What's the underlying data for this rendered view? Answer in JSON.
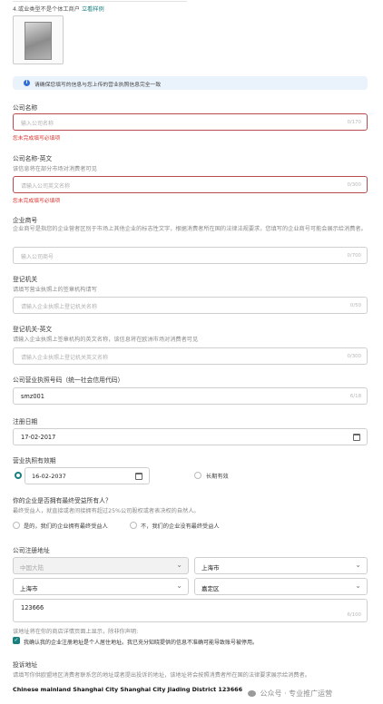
{
  "top": {
    "cut_text": "……………………………………………………………………………………",
    "note_prefix": "4.或业类型不是个体工商户",
    "note_link": "立看样例"
  },
  "info_banner": "请确保您填写的信息与您上传的营业执照信息完全一致",
  "company_name": {
    "label": "公司名称",
    "placeholder": "输入公司名称",
    "counter": "0/170",
    "error": "您未完成填写必填项"
  },
  "company_name_en": {
    "label": "公司名称-英文",
    "hint": "该信息将在部分市场对消费者可见",
    "placeholder": "请输入公司英文名称",
    "counter": "0/300",
    "error": "您未完成填写必填项"
  },
  "trade_name": {
    "label": "企业商号",
    "hint": "企业商号是指您的企业营者区别于市场上其他企业的标志性文字，根据消费者所在国的法律法规要求，您填写的企业商号可能会展示给消费者。",
    "placeholder": "输入公司商号",
    "counter": "0/700"
  },
  "registrar": {
    "label": "登记机关",
    "hint": "请填写营业执照上的签章机构请写",
    "placeholder": "请输入企业执照上登记机关名称",
    "counter": "0/50"
  },
  "registrar_en": {
    "label": "登记机关-英文",
    "hint": "请输入企业执照上签章机构的英文名称，该信息将在欧洲市场对消费者可见",
    "placeholder": "请输入企业执照上登记机关英文名称",
    "counter": "0/300"
  },
  "license_no": {
    "label": "公司营业执照号码（统一社会信用代码）",
    "value": "smz001",
    "counter": "6/18"
  },
  "reg_date": {
    "label": "注册日期",
    "value": "17-02-2017"
  },
  "validity": {
    "label": "营业执照有效期",
    "date": "16-02-2037",
    "long_term": "长期有效"
  },
  "beneficiary": {
    "question": "你的企业是否拥有最终受益所有人？",
    "hint": "最终受益人，就直接或者间接拥有超过25%公司股权或者表决权的自然人。",
    "option_yes": "是的，我们的企业拥有最终受益人",
    "option_no": "不，我们的企业没有最终受益人"
  },
  "address": {
    "label": "公司注册地址",
    "country": "中国大陆",
    "province": "上海市",
    "city": "上海市",
    "district": "嘉定区",
    "detail": "123666",
    "counter": "6/100",
    "note": "该地址将在你的商店详情页面上显示，除非你声明:",
    "declare": "我确认我的企业注册地址是个人居住地址。我已充分知晓提供的信息不准确可能导致账号被停用。"
  },
  "delivery": {
    "label": "投诉地址",
    "hint": "请填写你供欧盟地区消费者联系您的地址或者提出投诉的地址，该地址将会按照消费者所在国的法律要求展示给消费者。",
    "value": "Chinese mainland Shanghai City Shanghai City Jiading District 123666"
  },
  "watermark": "公众号 · 专业推广运营",
  "icons": {
    "info": "info-icon",
    "calendar": "calendar-icon",
    "chevron": "chevron-down-icon",
    "check": "checkmark-icon"
  },
  "colors": {
    "accent": "#1a7f7f",
    "error": "#d9312d",
    "banner_bg": "#eaf2fb",
    "banner_icon": "#2f6fd6"
  }
}
